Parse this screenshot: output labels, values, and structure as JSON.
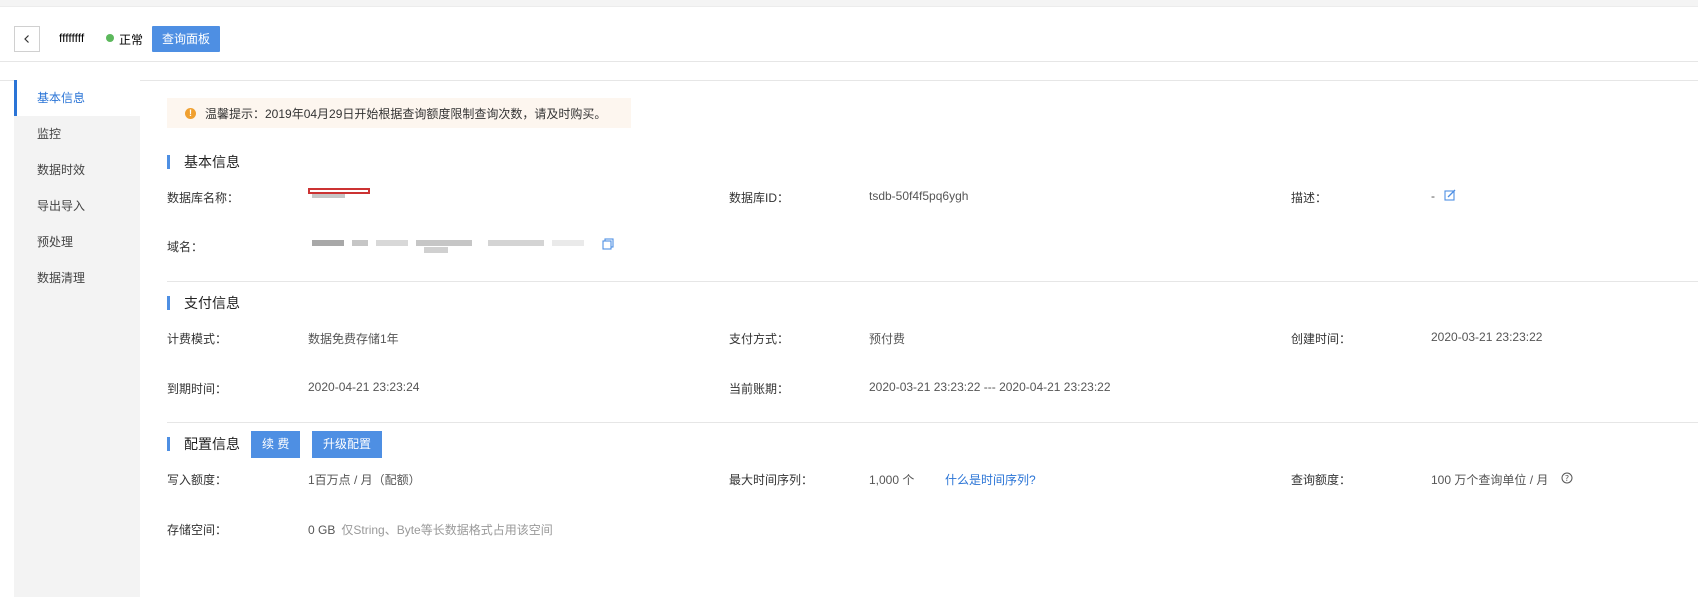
{
  "header": {
    "db_name": "ffffffff",
    "status": "正常",
    "query_button": "查询面板"
  },
  "sidebar": {
    "items": [
      {
        "label": "基本信息",
        "active": true
      },
      {
        "label": "监控",
        "active": false
      },
      {
        "label": "数据时效",
        "active": false
      },
      {
        "label": "导出导入",
        "active": false
      },
      {
        "label": "预处理",
        "active": false
      },
      {
        "label": "数据清理",
        "active": false
      }
    ]
  },
  "notice": "温馨提示：2019年04月29日开始根据查询额度限制查询次数，请及时购买。",
  "basic": {
    "title": "基本信息",
    "db_name_label": "数据库名称：",
    "db_id_label": "数据库ID：",
    "db_id_value": "tsdb-50f4f5pq6ygh",
    "desc_label": "描述：",
    "desc_value": "-",
    "domain_label": "域名："
  },
  "payment": {
    "title": "支付信息",
    "billing_mode_label": "计费模式：",
    "billing_mode_value": "数据免费存储1年",
    "pay_method_label": "支付方式：",
    "pay_method_value": "预付费",
    "created_label": "创建时间：",
    "created_value": "2020-03-21 23:23:22",
    "expire_label": "到期时间：",
    "expire_value": "2020-04-21 23:23:24",
    "period_label": "当前账期：",
    "period_value": "2020-03-21 23:23:22 --- 2020-04-21 23:23:22"
  },
  "config": {
    "title": "配置信息",
    "renew_button": "续 费",
    "upgrade_button": "升级配置",
    "write_quota_label": "写入额度：",
    "write_quota_value": "1百万点 / 月（配额）",
    "max_series_label": "最大时间序列：",
    "max_series_value": "1,000 个",
    "series_link": "什么是时间序列?",
    "query_quota_label": "查询额度：",
    "query_quota_value": "100 万个查询单位 / 月",
    "storage_label": "存储空间：",
    "storage_value": "0 GB",
    "storage_hint": "仅String、Byte等长数据格式占用该空间"
  },
  "colors": {
    "accent": "#4e8fe3",
    "status_ok": "#5cb85c",
    "warning": "#f0a030",
    "link": "#2a74d6"
  },
  "icons": [
    "back-arrow-icon",
    "status-dot-icon",
    "warning-icon",
    "edit-icon",
    "copy-icon",
    "help-icon"
  ]
}
